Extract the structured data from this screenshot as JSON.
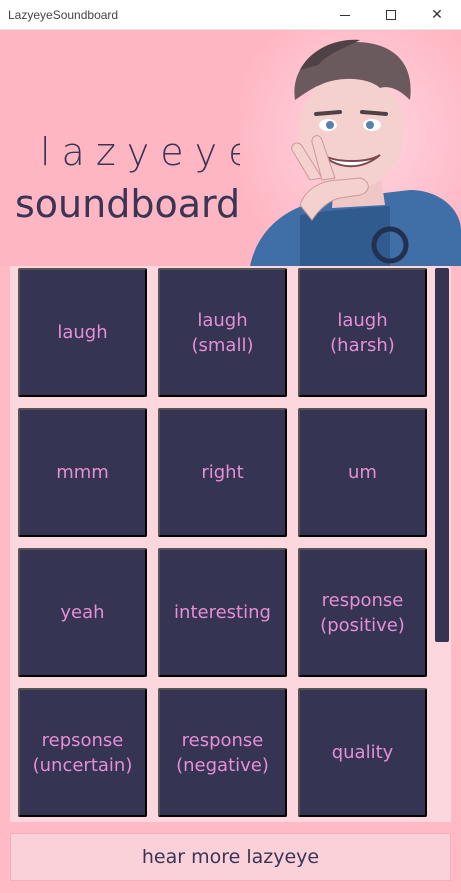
{
  "window": {
    "title": "LazyeyeSoundboard",
    "minimize_icon": "minimize-icon",
    "maximize_icon": "maximize-icon",
    "close_icon": "close-icon"
  },
  "header": {
    "logo_line1": "lazyeye",
    "logo_line2": "soundboard",
    "avatar_alt": "cartoon character waving peace sign"
  },
  "sounds": [
    {
      "label": "laugh"
    },
    {
      "label": "laugh (small)"
    },
    {
      "label": "laugh (harsh)"
    },
    {
      "label": "mmm"
    },
    {
      "label": "right"
    },
    {
      "label": "um"
    },
    {
      "label": "yeah"
    },
    {
      "label": "interesting"
    },
    {
      "label": "response\n(positive)"
    },
    {
      "label": "repsonse\n(uncertain)"
    },
    {
      "label": "response\n(negative)"
    },
    {
      "label": "quality"
    }
  ],
  "footer": {
    "button_label": "hear more lazyeye"
  },
  "colors": {
    "background": "#ffbac6",
    "tile": "#353452",
    "tile_text": "#e58fd5",
    "panel": "#fcd7de",
    "text_dark": "#3a3555"
  }
}
